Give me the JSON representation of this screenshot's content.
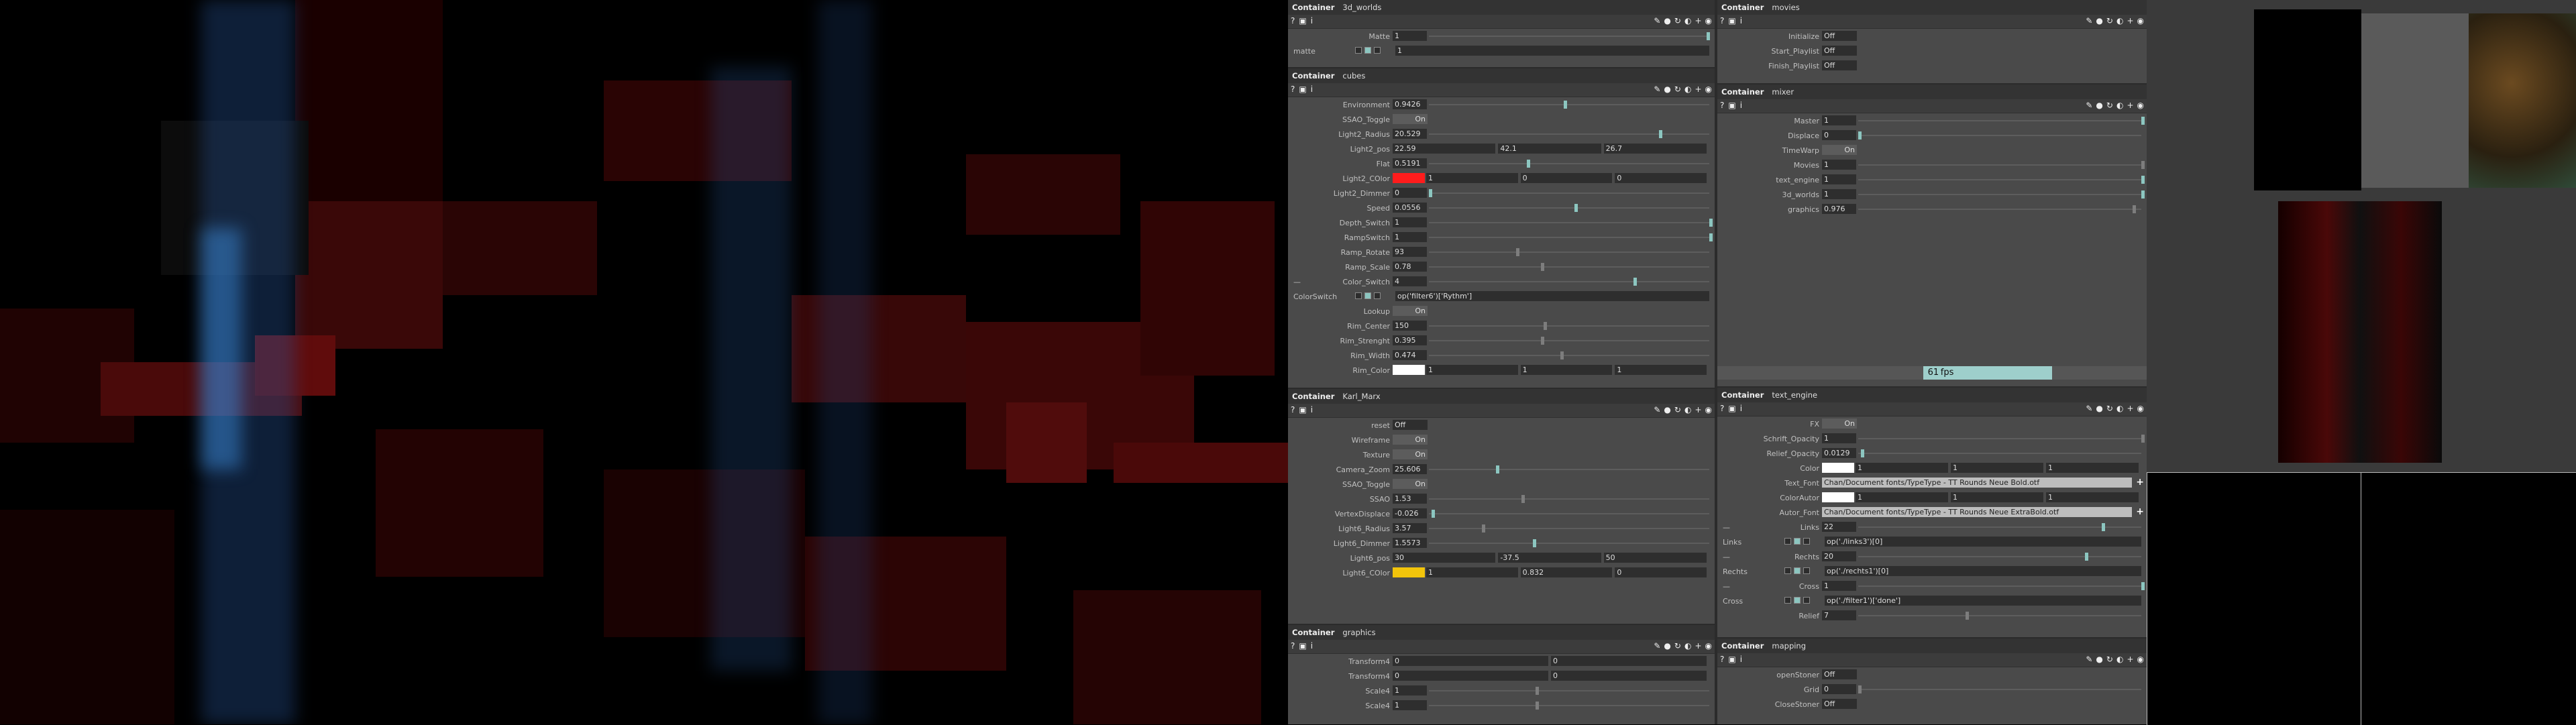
{
  "panels": {
    "worlds": {
      "kind": "Container",
      "name": "3d_worlds",
      "rows": [
        {
          "label": "Matte",
          "value": "1",
          "knob": 99
        },
        {
          "label": "matte",
          "type": "expr",
          "value": "1",
          "icons": true,
          "leftlabel": true
        }
      ]
    },
    "cubes": {
      "kind": "Container",
      "name": "cubes",
      "rows": [
        {
          "label": "Environment",
          "value": "0.9426",
          "knob": 48
        },
        {
          "label": "SSAO_Toggle",
          "type": "toggle",
          "value": "On"
        },
        {
          "label": "Light2_Radius",
          "value": "20.529",
          "knob": 82
        },
        {
          "label": "Light2_pos",
          "type": "multi",
          "values": [
            "22.59",
            "42.1",
            "26.7"
          ]
        },
        {
          "label": "Flat",
          "value": "0.5191",
          "knob": 35
        },
        {
          "label": "Light2_COlor",
          "type": "color",
          "color": "#ff1c1c",
          "values": [
            "1",
            "0",
            "0"
          ]
        },
        {
          "label": "Light2_Dimmer",
          "value": "0",
          "knob": 0
        },
        {
          "label": "Speed",
          "value": "0.0556",
          "knob": 52
        },
        {
          "label": "Depth_Switch",
          "value": "1",
          "knob": 100
        },
        {
          "label": "RampSwitch",
          "value": "1",
          "knob": 100
        },
        {
          "label": "Ramp_Rotate",
          "value": "93",
          "knob": 31,
          "gray": true
        },
        {
          "label": "Ramp_Scale",
          "value": "0.78",
          "knob": 40,
          "gray": true
        },
        {
          "label": "Color_Switch",
          "value": "4",
          "knob": 73,
          "leftdash": true
        },
        {
          "label": "ColorSwitch",
          "type": "expr",
          "value": "op('filter6')['Rythm']",
          "icons": true,
          "leftlabel": true
        },
        {
          "label": "Lookup",
          "type": "toggle",
          "value": "On"
        },
        {
          "label": "Rim_Center",
          "value": "150",
          "knob": 41,
          "gray": true
        },
        {
          "label": "Rim_Strenght",
          "value": "0.395",
          "knob": 40,
          "gray": true
        },
        {
          "label": "Rim_Width",
          "value": "0.474",
          "knob": 47,
          "gray": true
        },
        {
          "label": "Rim_Color",
          "type": "color",
          "color": "#ffffff",
          "values": [
            "1",
            "1",
            "1"
          ]
        }
      ]
    },
    "karl": {
      "kind": "Container",
      "name": "Karl_Marx",
      "rows": [
        {
          "label": "reset",
          "type": "toggle",
          "value": "Off",
          "off": true
        },
        {
          "label": "Wireframe",
          "type": "toggle",
          "value": "On"
        },
        {
          "label": "Texture",
          "type": "toggle",
          "value": "On"
        },
        {
          "label": "Camera_Zoom",
          "value": "25.606",
          "knob": 24
        },
        {
          "label": "SSAO_Toggle",
          "type": "toggle",
          "value": "On"
        },
        {
          "label": "SSAO",
          "value": "1.53",
          "knob": 33,
          "gray": true
        },
        {
          "label": "VertexDisplace",
          "value": "-0.026",
          "knob": 1
        },
        {
          "label": "Light6_Radius",
          "value": "3.57",
          "knob": 19,
          "gray": true
        },
        {
          "label": "Light6_Dimmer",
          "value": "1.5573",
          "knob": 37
        },
        {
          "label": "Light6_pos",
          "type": "multi",
          "values": [
            "30",
            "-37.5",
            "50"
          ]
        },
        {
          "label": "Light6_COlor",
          "type": "color",
          "color": "#f2c40b",
          "values": [
            "1",
            "0.832",
            "0"
          ]
        }
      ]
    },
    "graphics": {
      "kind": "Container",
      "name": "graphics",
      "rows": [
        {
          "label": "Transform4",
          "type": "multi2",
          "values": [
            "0",
            "0"
          ]
        },
        {
          "label": "Transform4",
          "type": "multi2",
          "values": [
            "0",
            "0"
          ]
        },
        {
          "label": "Scale4",
          "value": "1",
          "knob": 38,
          "gray": true
        },
        {
          "label": "Scale4",
          "value": "1",
          "knob": 38,
          "gray": true
        }
      ]
    },
    "movies": {
      "kind": "Container",
      "name": "movies",
      "rows": [
        {
          "label": "Initialize",
          "type": "toggle",
          "value": "Off",
          "off": true
        },
        {
          "label": "Start_Playlist",
          "type": "toggle",
          "value": "Off",
          "off": true
        },
        {
          "label": "Finish_Playlist",
          "type": "toggle",
          "value": "Off",
          "off": true
        }
      ]
    },
    "mixer": {
      "kind": "Container",
      "name": "mixer",
      "rows": [
        {
          "label": "Master",
          "value": "1",
          "knob": 100
        },
        {
          "label": "Displace",
          "value": "0",
          "knob": 0
        },
        {
          "label": "TimeWarp",
          "type": "toggle",
          "value": "On"
        },
        {
          "label": "Movies",
          "value": "1",
          "knob": 100,
          "gray": true
        },
        {
          "label": "text_engine",
          "value": "1",
          "knob": 100
        },
        {
          "label": "3d_worlds",
          "value": "1",
          "knob": 100
        },
        {
          "label": "graphics",
          "value": "0.976",
          "knob": 97,
          "gray": true
        }
      ],
      "fps": {
        "value": "61",
        "unit": "fps",
        "fill": 0.3
      }
    },
    "text": {
      "kind": "Container",
      "name": "text_engine",
      "rows": [
        {
          "label": "FX",
          "type": "toggle",
          "value": "On"
        },
        {
          "label": "Schrift_Opacity",
          "value": "1",
          "knob": 100,
          "gray": true
        },
        {
          "label": "Relief_Opacity",
          "value": "0.0129",
          "knob": 1
        },
        {
          "label": "Color",
          "type": "color",
          "color": "#ffffff",
          "values": [
            "1",
            "1",
            "1"
          ]
        },
        {
          "label": "Text_Font",
          "type": "font",
          "value": "Chan/Document fonts/TypeType - TT Rounds Neue Bold.otf"
        },
        {
          "label": "ColorAutor",
          "type": "color",
          "color": "#ffffff",
          "values": [
            "1",
            "1",
            "1"
          ]
        },
        {
          "label": "Autor_Font",
          "type": "font",
          "value": "Chan/Document fonts/TypeType - TT Rounds Neue ExtraBold.otf"
        },
        {
          "label": "Links",
          "value": "22",
          "knob": 86,
          "leftdash": true
        },
        {
          "label": "Links",
          "type": "expr",
          "value": "op('./links3')[0]",
          "icons": true,
          "leftlabel": true
        },
        {
          "label": "Rechts",
          "value": "20",
          "knob": 80,
          "leftdash": true
        },
        {
          "label": "Rechts",
          "type": "expr",
          "value": "op('./rechts1')[0]",
          "icons": true,
          "leftlabel": true
        },
        {
          "label": "Cross",
          "value": "1",
          "knob": 100,
          "leftdash": true
        },
        {
          "label": "Cross",
          "type": "expr",
          "value": "op('./filter1')['done']",
          "icons": true,
          "leftlabel": true
        },
        {
          "label": "Relief",
          "value": "7",
          "knob": 38,
          "gray": true
        }
      ]
    },
    "mapping": {
      "kind": "Container",
      "name": "mapping",
      "rows": [
        {
          "label": "openStoner",
          "type": "toggle",
          "value": "Off",
          "off": true
        },
        {
          "label": "Grid",
          "value": "0",
          "knob": 0,
          "gray": true
        },
        {
          "label": "CloseStoner",
          "type": "toggle",
          "value": "Off",
          "off": true
        }
      ]
    }
  },
  "toolbar": {
    "help": "?",
    "info": "i",
    "add": "+"
  },
  "colors": {
    "accent": "#8cc6c0",
    "panel": "#4a4a4a",
    "field": "#2e2e2e",
    "header": "#333333"
  }
}
